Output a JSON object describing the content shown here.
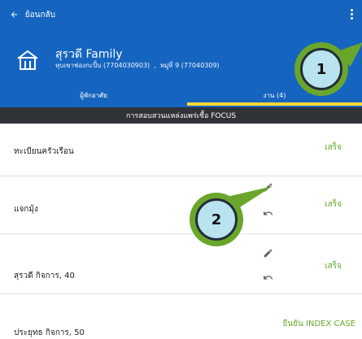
{
  "header": {
    "back_label": "ย้อนกลับ",
    "family_name": "สุรวดี Family",
    "subdistrict": "หุบเขาช่องกะปิ้บ (7704030903)",
    "separator": ",",
    "village": "หมู่ที่ 9 (77040309)"
  },
  "tabs": [
    {
      "label": "ผู้พักอาศัย",
      "active": false
    },
    {
      "label": "งาน (4)",
      "active": true
    }
  ],
  "section_title": "การสอบสวนแหล่งแพร่เชื้อ FOCUS",
  "rows": [
    {
      "title": "ทะเบียนครัวเรือน",
      "status": "เสร็จ"
    },
    {
      "title": "แจกมุ้ง",
      "status": "เสร็จ"
    },
    {
      "title": "สุรวดี  กิจการ, 40",
      "status": "เสร็จ"
    },
    {
      "title": "ประยุทธ  กิจการ, 50",
      "status": "ยืนยัน INDEX CASE"
    }
  ],
  "callouts": [
    "1",
    "2"
  ],
  "icons": {
    "back": "arrow-left-icon",
    "menu": "more-vert-icon",
    "house": "house-icon",
    "edit": "pencil-icon",
    "undo": "undo-icon"
  },
  "colors": {
    "appbar": "#1565c0",
    "tab_indicator": "#fdd835",
    "section_bar": "#2f3338",
    "status_green": "#66a82c",
    "callout_green": "#6aa62c",
    "callout_fill": "#b9e3ee"
  }
}
